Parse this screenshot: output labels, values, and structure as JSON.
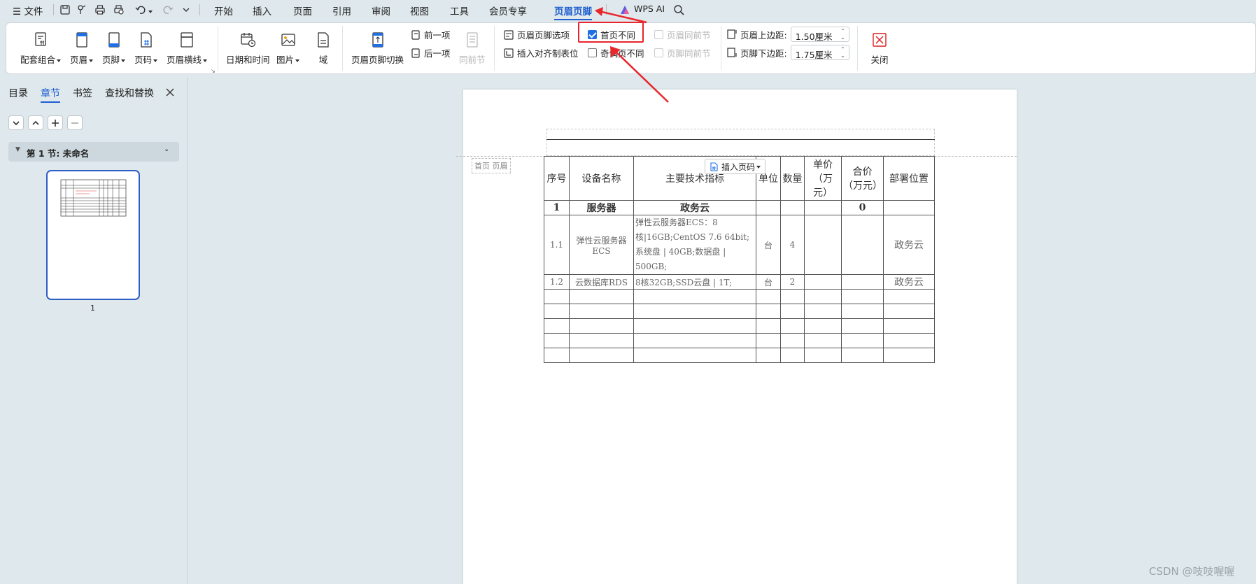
{
  "menubar": {
    "file_label": "文件",
    "tabs": [
      "开始",
      "插入",
      "页面",
      "引用",
      "审阅",
      "视图",
      "工具",
      "会员专享",
      "页眉页脚"
    ],
    "active_tab": "页眉页脚",
    "ai_label": "WPS AI"
  },
  "ribbon": {
    "groups": {
      "combo": "配套组合",
      "header": "页眉",
      "footer": "页脚",
      "pagenum": "页码",
      "header_line": "页眉横线",
      "datetime": "日期和时间",
      "picture": "图片",
      "field": "域",
      "switch": "页眉页脚切换",
      "prev": "前一项",
      "next": "后一项",
      "same_prev": "同前节",
      "options": "页眉页脚选项",
      "align_tab": "插入对齐制表位",
      "first_diff": "首页不同",
      "odd_even": "奇偶页不同",
      "header_same_prev": "页眉同前节",
      "footer_same_prev": "页脚同前节",
      "header_top_label": "页眉上边距:",
      "header_top_value": "1.50厘米",
      "footer_bottom_label": "页脚下边距:",
      "footer_bottom_value": "1.75厘米",
      "close": "关闭"
    },
    "first_diff_checked": true,
    "odd_even_checked": false
  },
  "leftpanel": {
    "tabs": [
      "目录",
      "章节",
      "书签",
      "查找和替换"
    ],
    "active_tab": "章节",
    "section_title": "第 1 节: 未命名",
    "page_number": "1"
  },
  "document": {
    "header_tag": "首页 页眉",
    "insert_pagenum": "插入页码",
    "table": {
      "headers": [
        "序号",
        "设备名称",
        "主要技术指标",
        "单位",
        "数量",
        "单价（万元）",
        "合价（万元）",
        "部署位置"
      ],
      "rows": [
        [
          "1",
          "服务器",
          "政务云",
          "",
          "",
          "",
          "0",
          ""
        ],
        [
          "1.1",
          "弹性云服务器ECS",
          "弹性云服务器ECS：8核|16GB;CentOS 7.6 64bit;系统盘 | 40GB;数据盘 | 500GB;",
          "台",
          "4",
          "",
          "",
          "政务云"
        ],
        [
          "1.2",
          "云数据库RDS",
          "8核32GB;SSD云盘 | 1T;",
          "台",
          "2",
          "",
          "",
          "政务云"
        ]
      ]
    }
  },
  "watermark": "CSDN @吱吱喔喔",
  "accent_color": "#1f5fd0",
  "highlight_color": "#e8262b"
}
